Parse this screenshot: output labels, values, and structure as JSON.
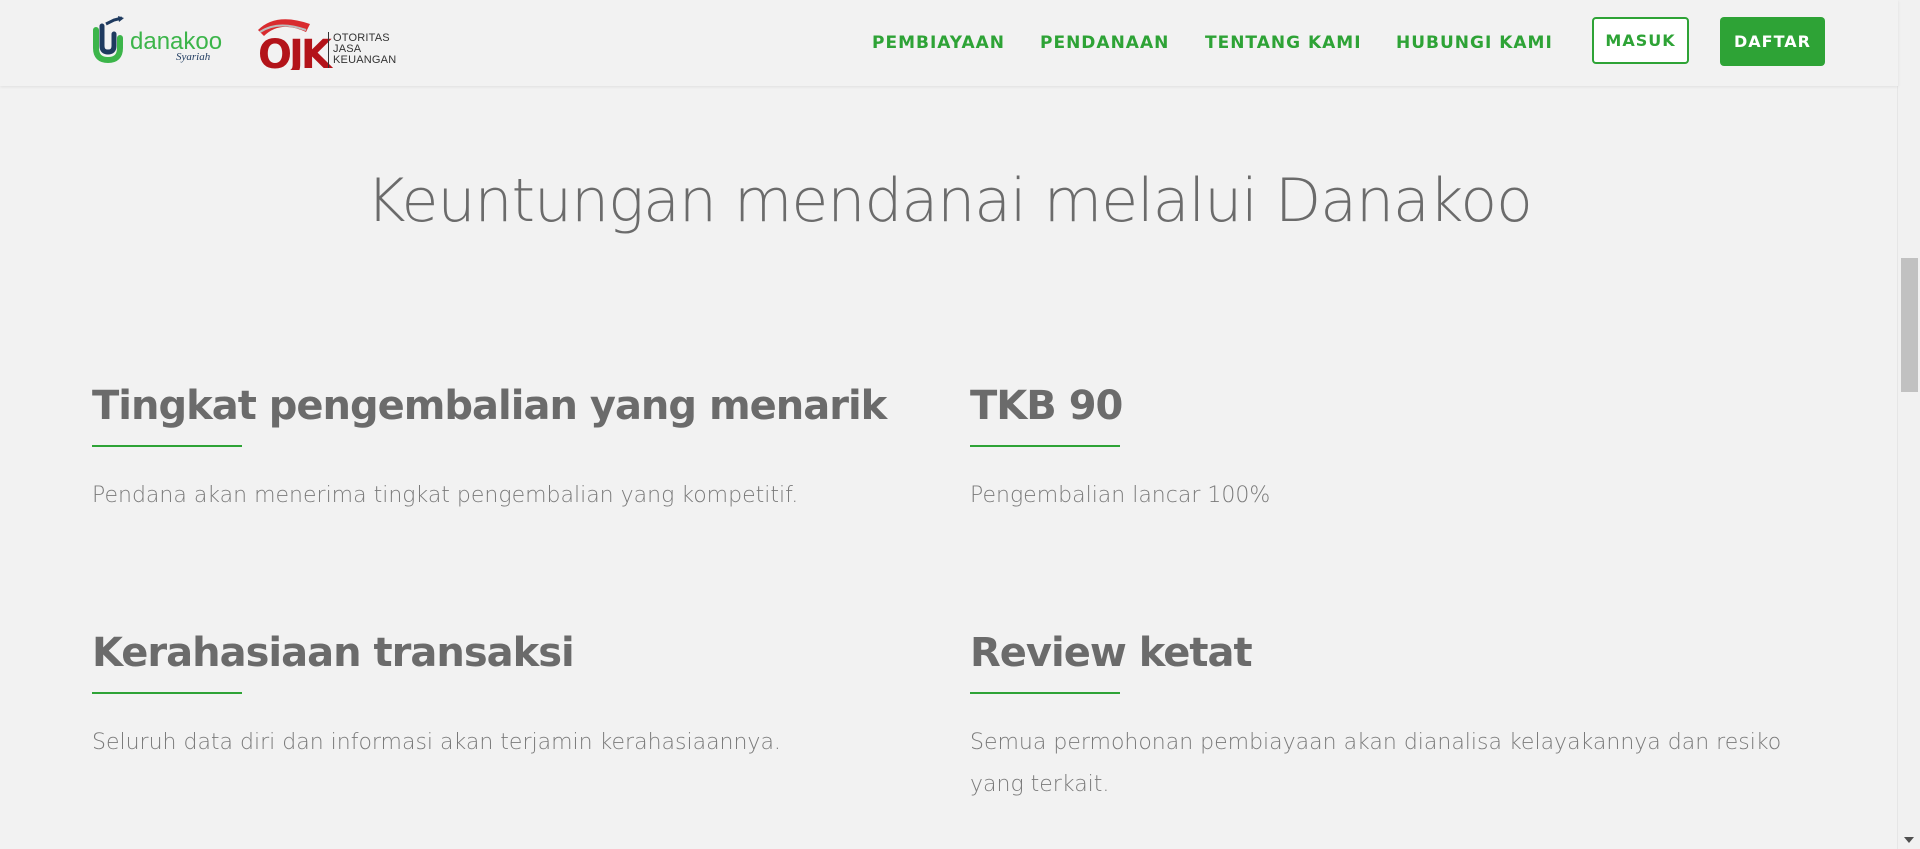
{
  "brand": {
    "name": "danakoo",
    "tagline": "Syariah",
    "ojk_mark": "OJK",
    "ojk_lines": [
      "OTORITAS",
      "JASA",
      "KEUANGAN"
    ]
  },
  "nav": {
    "links": [
      "PEMBIAYAAN",
      "PENDANAAN",
      "TENTANG KAMI",
      "HUBUNGI KAMI"
    ],
    "login_label": "MASUK",
    "register_label": "DAFTAR"
  },
  "section": {
    "title": "Keuntungan mendanai melalui Danakoo"
  },
  "features": [
    {
      "title": "Tingkat pengembalian yang menarik",
      "desc": "Pendana akan menerima tingkat pengembalian yang kompetitif."
    },
    {
      "title": "TKB 90",
      "desc": "Pengembalian lancar 100%"
    },
    {
      "title": "Kerahasiaan transaksi",
      "desc": "Seluruh data diri dan informasi akan terjamin kerahasiaannya."
    },
    {
      "title": "Review ketat",
      "desc": "Semua permohonan pembiayaan akan dianalisa kelayakannya dan resiko yang terkait."
    }
  ],
  "colors": {
    "accent": "#2ea336",
    "background": "#f2f2f2",
    "heading": "#6b6b6b",
    "body_text": "#7a7a7a",
    "ojk_red": "#b3141a"
  }
}
